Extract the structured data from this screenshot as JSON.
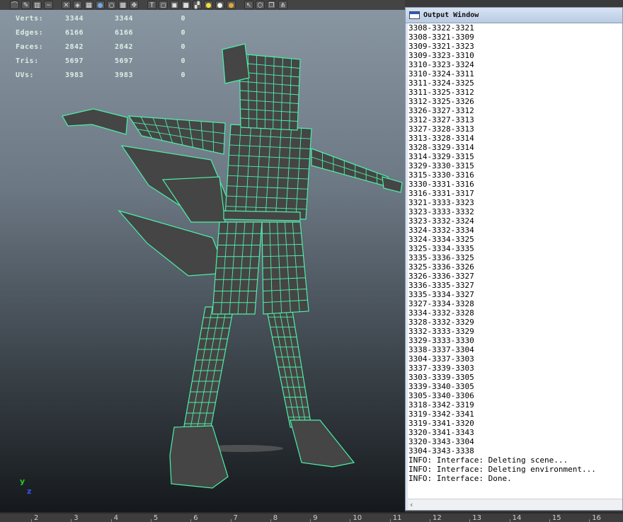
{
  "toolbar": {
    "icons": [
      "lasso-icon",
      "paint-icon",
      "film-icon",
      "curve-icon",
      "xray-icon",
      "wireframe-icon",
      "grid-icon",
      "sphere-shaded-icon",
      "sphere-flat-icon",
      "checker-icon",
      "move-tool-icon",
      "text-icon",
      "cube-icon",
      "cube-selected-icon",
      "cube-solid-icon",
      "checkerboard-icon",
      "light-yellow-icon",
      "light-white-icon",
      "light-orange-icon",
      "select-icon",
      "box-icon",
      "layers-icon",
      "share-icon"
    ]
  },
  "hud": {
    "rows": [
      {
        "label": "Verts:",
        "v1": "3344",
        "v2": "3344",
        "v3": "0"
      },
      {
        "label": "Edges:",
        "v1": "6166",
        "v2": "6166",
        "v3": "0"
      },
      {
        "label": "Faces:",
        "v1": "2842",
        "v2": "2842",
        "v3": "0"
      },
      {
        "label": "Tris:",
        "v1": "5697",
        "v2": "5697",
        "v3": "0"
      },
      {
        "label": "UVs:",
        "v1": "3983",
        "v2": "3983",
        "v3": "0"
      }
    ]
  },
  "axis": {
    "y": "y",
    "z": "z"
  },
  "output_window": {
    "title": "Output Window",
    "lines": [
      "3308-3322-3321",
      "3308-3321-3309",
      "3309-3321-3323",
      "3309-3323-3310",
      "3310-3323-3324",
      "3310-3324-3311",
      "3311-3324-3325",
      "3311-3325-3312",
      "3312-3325-3326",
      "3326-3327-3312",
      "3312-3327-3313",
      "3327-3328-3313",
      "3313-3328-3314",
      "3328-3329-3314",
      "3314-3329-3315",
      "3329-3330-3315",
      "3315-3330-3316",
      "3330-3331-3316",
      "3316-3331-3317",
      "3321-3333-3323",
      "3323-3333-3332",
      "3323-3332-3324",
      "3324-3332-3334",
      "3324-3334-3325",
      "3325-3334-3335",
      "3335-3336-3325",
      "3325-3336-3326",
      "3326-3336-3327",
      "3336-3335-3327",
      "3335-3334-3327",
      "3327-3334-3328",
      "3334-3332-3328",
      "3328-3332-3329",
      "3332-3333-3329",
      "3329-3333-3330",
      "3338-3337-3304",
      "3304-3337-3303",
      "3337-3339-3303",
      "3303-3339-3305",
      "3339-3340-3305",
      "3305-3340-3306",
      "3318-3342-3319",
      "3319-3342-3341",
      "3319-3341-3320",
      "3320-3341-3343",
      "3320-3343-3304",
      "3304-3343-3338",
      "INFO: Interface: Deleting scene...",
      "INFO: Interface: Deleting environment...",
      "INFO: Interface: Done."
    ]
  },
  "timeline": {
    "ticks": [
      "2",
      "3",
      "4",
      "5",
      "6",
      "7",
      "8",
      "9",
      "10",
      "11",
      "12",
      "13",
      "14",
      "15",
      "16"
    ]
  },
  "colors": {
    "wireframe": "#4cf0a8",
    "mesh_fill": "#454545"
  }
}
